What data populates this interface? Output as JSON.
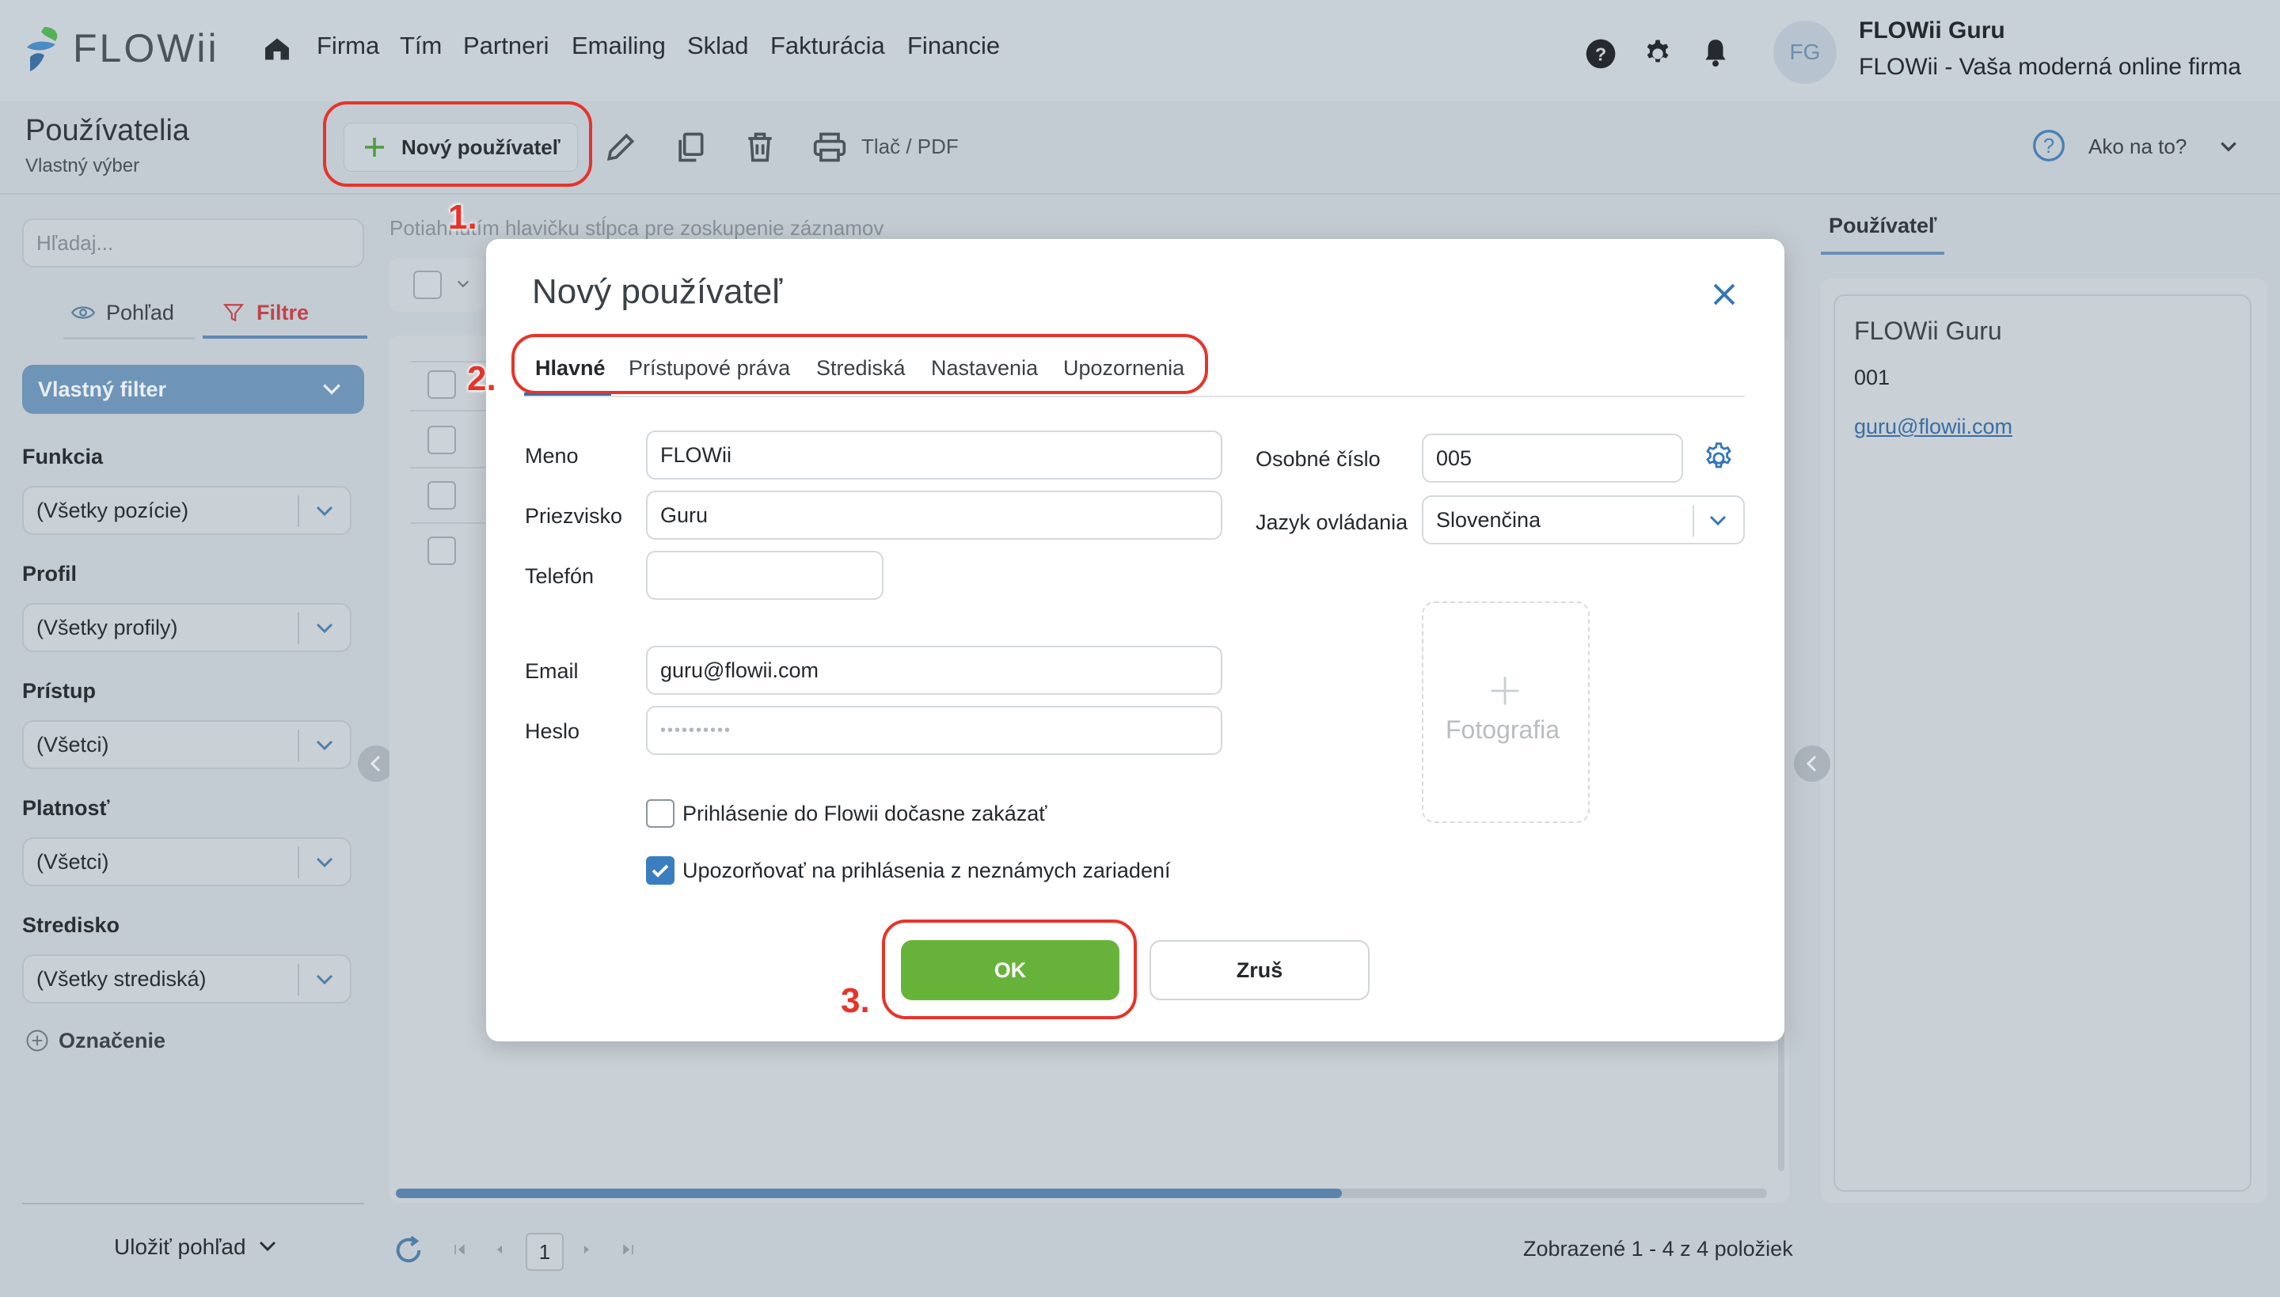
{
  "app": {
    "logo_text": "FLOWii",
    "nav": [
      "Firma",
      "Tím",
      "Partneri",
      "Emailing",
      "Sklad",
      "Fakturácia",
      "Financie"
    ],
    "user": {
      "initials": "FG",
      "name": "FLOWii Guru",
      "company": "FLOWii - Vaša moderná online firma"
    }
  },
  "toolbar": {
    "title": "Používatelia",
    "subtitle": "Vlastný výber",
    "new_user_label": "Nový používateľ",
    "print_label": "Tlač / PDF",
    "help_label": "Ako na to?"
  },
  "annotations": {
    "step1": "1.",
    "step2": "2.",
    "step3": "3."
  },
  "sidebar": {
    "search_placeholder": "Hľadaj...",
    "tab_view": "Pohľad",
    "tab_filters": "Filtre",
    "custom_filter": "Vlastný filter",
    "filters": [
      {
        "label": "Funkcia",
        "value": "(Všetky pozície)"
      },
      {
        "label": "Profil",
        "value": "(Všetky profily)"
      },
      {
        "label": "Prístup",
        "value": "(Všetci)"
      },
      {
        "label": "Platnosť",
        "value": "(Všetci)"
      },
      {
        "label": "Stredisko",
        "value": "(Všetky strediská)"
      }
    ],
    "tag_label": "Označenie",
    "save_view": "Uložiť pohľad"
  },
  "grid": {
    "group_hint": "Potiahnutím hlavičku stĺpca pre zoskupenie záznamov",
    "page": "1",
    "summary": "Zobrazené 1 - 4 z 4 položiek",
    "hscroll_fraction": 0.69
  },
  "right_panel": {
    "tab": "Používateľ",
    "name": "FLOWii Guru",
    "number": "001",
    "email": "guru@flowii.com"
  },
  "modal": {
    "title": "Nový používateľ",
    "tabs": [
      "Hlavné",
      "Prístupové práva",
      "Strediská",
      "Nastavenia",
      "Upozornenia"
    ],
    "active_tab": "Hlavné",
    "fields": {
      "meno_label": "Meno",
      "meno_value": "FLOWii",
      "priezvisko_label": "Priezvisko",
      "priezvisko_value": "Guru",
      "telefon_label": "Telefón",
      "telefon_value": "",
      "email_label": "Email",
      "email_value": "guru@flowii.com",
      "heslo_label": "Heslo",
      "heslo_value": "••••••••••",
      "osobne_cislo_label": "Osobné číslo",
      "osobne_cislo_value": "005",
      "jazyk_label": "Jazyk ovládania",
      "jazyk_value": "Slovenčina"
    },
    "photo_label": "Fotografia",
    "checkbox_disable_login": {
      "label": "Prihlásenie do Flowii dočasne zakázať",
      "checked": false
    },
    "checkbox_notify": {
      "label": "Upozorňovať na prihlásenia z neznámych zariadení",
      "checked": true
    },
    "ok_label": "OK",
    "cancel_label": "Zruš"
  },
  "colors": {
    "accent_blue": "#3b7ec0",
    "ok_green": "#67b33a",
    "annotation_red": "#e6342a",
    "filter_active": "#c0444b"
  }
}
